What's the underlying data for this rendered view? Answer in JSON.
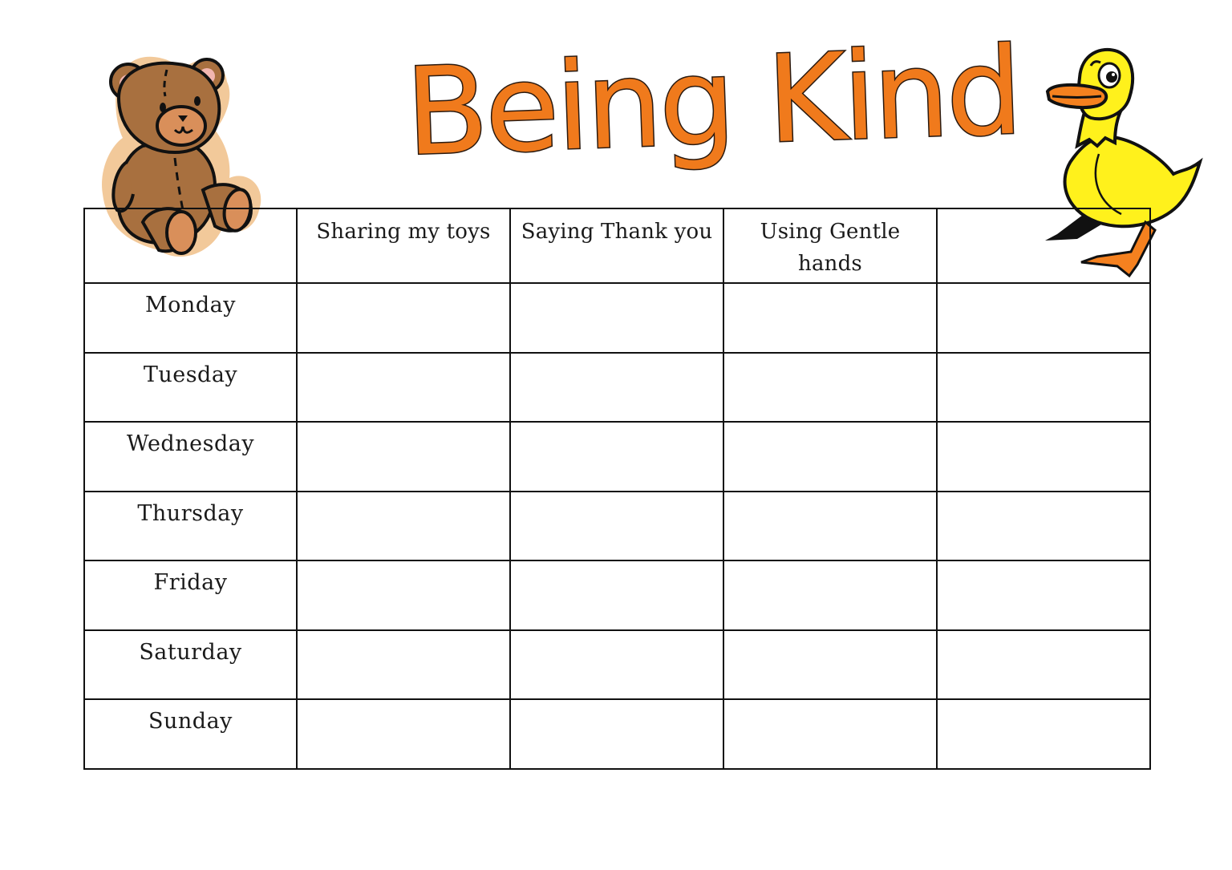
{
  "document": {
    "title": "Being Kind",
    "title_color": "#f07a1c",
    "title_outline_color": "#2a1a10"
  },
  "illustrations": {
    "left": {
      "icon": "teddy-bear-icon",
      "fill": "#a8703f",
      "outline": "#f2c99a"
    },
    "right": {
      "icon": "duck-icon",
      "fill": "#fff11c",
      "accent": "#f5811f"
    }
  },
  "table": {
    "corner_label": "",
    "columns": [
      "Sharing my toys",
      "Saying Thank you",
      "Using Gentle hands",
      ""
    ],
    "rows": [
      {
        "day": "Monday",
        "cells": [
          "",
          "",
          "",
          ""
        ]
      },
      {
        "day": "Tuesday",
        "cells": [
          "",
          "",
          "",
          ""
        ]
      },
      {
        "day": "Wednesday",
        "cells": [
          "",
          "",
          "",
          ""
        ]
      },
      {
        "day": "Thursday",
        "cells": [
          "",
          "",
          "",
          ""
        ]
      },
      {
        "day": "Friday",
        "cells": [
          "",
          "",
          "",
          ""
        ]
      },
      {
        "day": "Saturday",
        "cells": [
          "",
          "",
          "",
          ""
        ]
      },
      {
        "day": "Sunday",
        "cells": [
          "",
          "",
          "",
          ""
        ]
      }
    ]
  }
}
